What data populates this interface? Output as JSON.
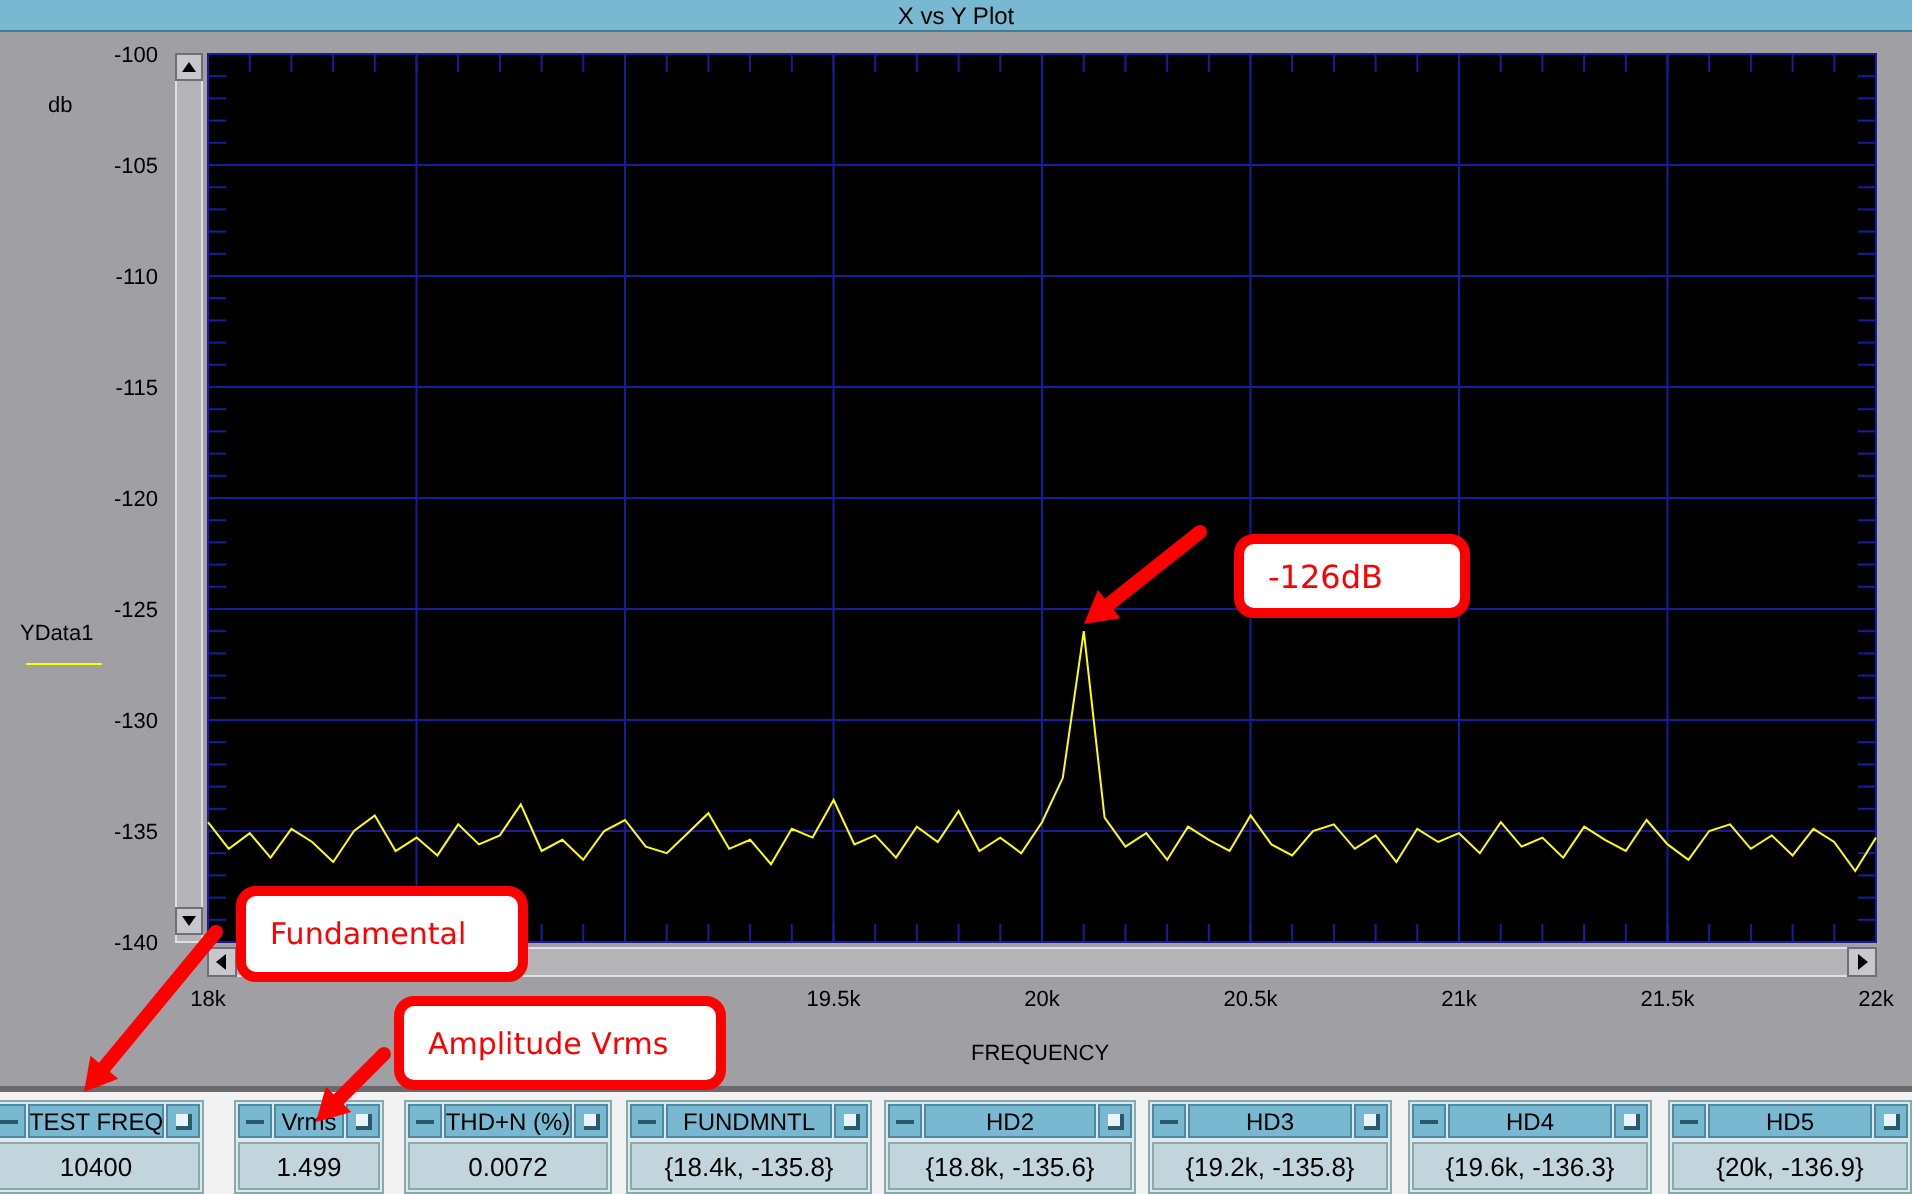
{
  "window": {
    "title": "X vs Y Plot"
  },
  "plot": {
    "y_unit": "db",
    "chart_data": {
      "type": "line",
      "grid": true,
      "xlabel": "FREQUENCY",
      "xlim": [
        18,
        22
      ],
      "ylim": [
        -140,
        -100
      ],
      "xticks": [
        {
          "value": 18,
          "label": "18k"
        },
        {
          "value": 19.5,
          "label": "19.5k"
        },
        {
          "value": 20,
          "label": "20k"
        },
        {
          "value": 20.5,
          "label": "20.5k"
        },
        {
          "value": 21,
          "label": "21k"
        },
        {
          "value": 21.5,
          "label": "21.5k"
        },
        {
          "value": 22,
          "label": "22k"
        }
      ],
      "yticks": [
        -100,
        -105,
        -110,
        -115,
        -120,
        -125,
        -130,
        -135,
        -140
      ],
      "x": [
        18,
        18.05,
        18.1,
        18.15,
        18.2,
        18.25,
        18.3,
        18.35,
        18.4,
        18.45,
        18.5,
        18.55,
        18.6,
        18.65,
        18.7,
        18.75,
        18.8,
        18.85,
        18.9,
        18.95,
        19,
        19.05,
        19.1,
        19.15,
        19.2,
        19.25,
        19.3,
        19.35,
        19.4,
        19.45,
        19.5,
        19.55,
        19.6,
        19.65,
        19.7,
        19.75,
        19.8,
        19.85,
        19.9,
        19.95,
        20,
        20.05,
        20.1,
        20.15,
        20.2,
        20.25,
        20.3,
        20.35,
        20.4,
        20.45,
        20.5,
        20.55,
        20.6,
        20.65,
        20.7,
        20.75,
        20.8,
        20.85,
        20.9,
        20.95,
        21,
        21.05,
        21.1,
        21.15,
        21.2,
        21.25,
        21.3,
        21.35,
        21.4,
        21.45,
        21.5,
        21.55,
        21.6,
        21.65,
        21.7,
        21.75,
        21.8,
        21.85,
        21.9,
        21.95,
        22
      ],
      "series": [
        {
          "name": "YData1",
          "color": "#ffff00",
          "values": [
            -134.6,
            -135.8,
            -135.1,
            -136.2,
            -134.9,
            -135.5,
            -136.4,
            -135.0,
            -134.3,
            -135.9,
            -135.3,
            -136.1,
            -134.7,
            -135.6,
            -135.2,
            -133.8,
            -135.9,
            -135.4,
            -136.3,
            -135.0,
            -134.5,
            -135.7,
            -136.0,
            -135.1,
            -134.2,
            -135.8,
            -135.4,
            -136.5,
            -134.9,
            -135.3,
            -133.6,
            -135.6,
            -135.2,
            -136.2,
            -134.8,
            -135.5,
            -134.1,
            -135.9,
            -135.3,
            -136.0,
            -134.6,
            -132.6,
            -126.0,
            -134.4,
            -135.7,
            -135.1,
            -136.3,
            -134.8,
            -135.4,
            -135.9,
            -134.3,
            -135.6,
            -136.1,
            -135.0,
            -134.7,
            -135.8,
            -135.2,
            -136.4,
            -134.9,
            -135.5,
            -135.1,
            -136.0,
            -134.6,
            -135.7,
            -135.3,
            -136.2,
            -134.8,
            -135.4,
            -135.9,
            -134.5,
            -135.6,
            -136.3,
            -135.0,
            -134.7,
            -135.8,
            -135.2,
            -136.1,
            -134.9,
            -135.5,
            -136.8,
            -135.3
          ]
        }
      ]
    }
  },
  "objects": [
    {
      "title": "TEST FREQ",
      "value": "10400"
    },
    {
      "title": "Vrms",
      "value": "1.499"
    },
    {
      "title": "THD+N (%)",
      "value": "0.0072"
    },
    {
      "title": "FUNDMNTL",
      "value": "{18.4k, -135.8}"
    },
    {
      "title": "HD2",
      "value": "{18.8k, -135.6}"
    },
    {
      "title": "HD3",
      "value": "{19.2k, -135.8}"
    },
    {
      "title": "HD4",
      "value": "{19.6k, -136.3}"
    },
    {
      "title": "HD5",
      "value": "{20k, -136.9}"
    }
  ],
  "callouts": [
    {
      "text": "-126dB"
    },
    {
      "text": "Fundamental"
    },
    {
      "text": "Amplitude Vrms"
    }
  ]
}
